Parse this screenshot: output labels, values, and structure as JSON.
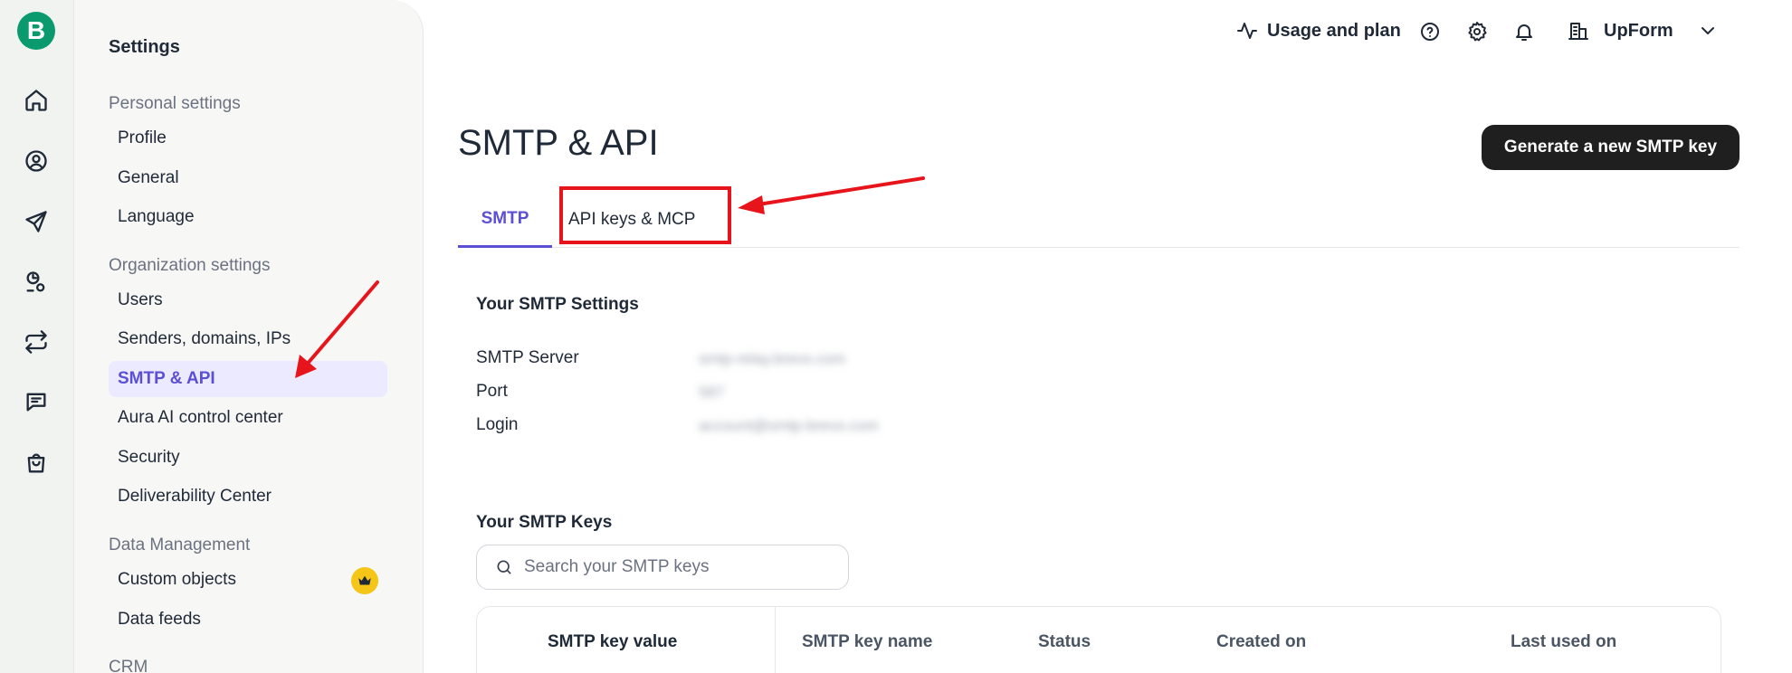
{
  "rail": {
    "logo_letter": "B",
    "icons": [
      "home-icon",
      "contacts-icon",
      "campaigns-icon",
      "automations-icon",
      "workflows-icon",
      "conversations-icon",
      "ecommerce-icon"
    ]
  },
  "sidebar": {
    "title": "Settings",
    "sections": [
      {
        "label": "Personal settings",
        "items": [
          "Profile",
          "General",
          "Language"
        ]
      },
      {
        "label": "Organization settings",
        "items": [
          "Users",
          "Senders, domains, IPs",
          "SMTP & API",
          "Aura AI control center",
          "Security",
          "Deliverability Center"
        ]
      },
      {
        "label": "Data Management",
        "items": [
          "Custom objects",
          "Data feeds"
        ]
      },
      {
        "label": "CRM",
        "items": []
      }
    ],
    "active_item": "SMTP & API"
  },
  "topbar": {
    "usage_label": "Usage and plan",
    "org_name": "UpForm",
    "icons": [
      "activity-icon",
      "help-icon",
      "gear-icon",
      "bell-icon",
      "building-icon",
      "chevron-down-icon"
    ]
  },
  "main": {
    "title": "SMTP & API",
    "generate_button": "Generate a new SMTP key",
    "tabs": [
      {
        "label": "SMTP",
        "active": true
      },
      {
        "label": "API keys & MCP",
        "active": false
      }
    ],
    "smtp_settings": {
      "title": "Your SMTP Settings",
      "rows": [
        {
          "label": "SMTP Server",
          "value": "smtp-relay.brevo.com"
        },
        {
          "label": "Port",
          "value": "587"
        },
        {
          "label": "Login",
          "value": "account@smtp-brevo.com"
        }
      ]
    },
    "smtp_keys": {
      "title": "Your SMTP Keys",
      "search_placeholder": "Search your SMTP keys",
      "columns": [
        "SMTP key value",
        "SMTP key name",
        "Status",
        "Created on",
        "Last used on"
      ]
    }
  },
  "colors": {
    "brand": "#0b996e",
    "accent": "#5b4fd6",
    "annotation": "#e8141b",
    "premium": "#f5c518"
  }
}
